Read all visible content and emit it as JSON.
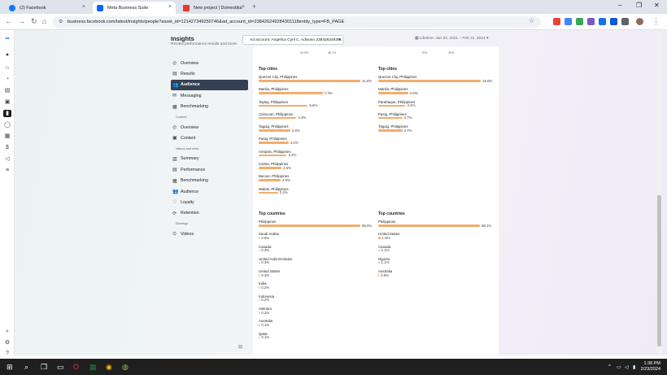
{
  "browser": {
    "tabs": [
      {
        "label": "(2) Facebook",
        "color": "#1877f2"
      },
      {
        "label": "Meta Business Suite",
        "color": "#0866ff"
      },
      {
        "label": "New project | Domestika",
        "color": "#e03c31"
      }
    ],
    "new_tab": "+",
    "url": "business.facebook.com/latest/insights/people?asset_id=121427349250746&ad_account_id=238426249284301118entity_type=FB_PAGE"
  },
  "header": {
    "title": "Insights",
    "subtitle": "Review performance results and more.",
    "ad_account": "Ad account: Angelica Cyril C. Adivoso 23842624928...",
    "date_range": "Lifetime: Jan 22, 2021 – Feb 21, 2024"
  },
  "nav": {
    "items_top": [
      {
        "label": "Overview",
        "icon": "overview-icon",
        "glyph": "◎"
      },
      {
        "label": "Results",
        "icon": "results-icon",
        "glyph": "▤"
      },
      {
        "label": "Audience",
        "icon": "audience-icon",
        "glyph": "👥",
        "active": true
      },
      {
        "label": "Messaging",
        "icon": "messaging-icon",
        "glyph": "✉"
      },
      {
        "label": "Benchmarking",
        "icon": "benchmarking-icon",
        "glyph": "▦"
      }
    ],
    "content_section": "Content",
    "items_content": [
      {
        "label": "Overview",
        "icon": "overview-icon",
        "glyph": "◎"
      },
      {
        "label": "Content",
        "icon": "content-icon",
        "glyph": "▣"
      }
    ],
    "videos_section": "Videos and reels",
    "items_videos": [
      {
        "label": "Summary",
        "icon": "summary-icon",
        "glyph": "▥"
      },
      {
        "label": "Performance",
        "icon": "performance-icon",
        "glyph": "▤"
      },
      {
        "label": "Benchmarking",
        "icon": "benchmarking-icon",
        "glyph": "▦"
      },
      {
        "label": "Audience",
        "icon": "audience-icon",
        "glyph": "👥"
      },
      {
        "label": "Loyalty",
        "icon": "loyalty-icon",
        "glyph": "♡"
      },
      {
        "label": "Retention",
        "icon": "retention-icon",
        "glyph": "⟳"
      }
    ],
    "earnings_section": "Earnings",
    "items_earnings": [
      {
        "label": "Videos",
        "icon": "videos-icon",
        "glyph": "⊙"
      }
    ]
  },
  "top_pcts": {
    "left_a": "53.9%",
    "left_b": "46.1%",
    "right_a": "70%",
    "right_b": "30%"
  },
  "left_cities": {
    "title": "Top cities",
    "rows": [
      {
        "name": "Quezon City, Philippines",
        "label": "11.6%",
        "value": 11.6
      },
      {
        "name": "Manila, Philippines",
        "label": "7.3%",
        "value": 7.3
      },
      {
        "name": "Taytay, Philippines",
        "label": "5.6%",
        "value": 5.6
      },
      {
        "name": "Caloocan, Philippines",
        "label": "4.3%",
        "value": 4.3
      },
      {
        "name": "Taguig, Philippines",
        "label": "3.6%",
        "value": 3.6
      },
      {
        "name": "Pasig, Philippines",
        "label": "3.4%",
        "value": 3.4
      },
      {
        "name": "Antipolo, Philippines",
        "label": "3.2%",
        "value": 3.2
      },
      {
        "name": "Cainta, Philippines",
        "label": "2.6%",
        "value": 2.6
      },
      {
        "name": "Bacoor, Philippines",
        "label": "2.5%",
        "value": 2.5
      },
      {
        "name": "Makati, Philippines",
        "label": "2.2%",
        "value": 2.2
      }
    ]
  },
  "right_cities": {
    "title": "Top cities",
    "rows": [
      {
        "name": "Quezon City, Philippines",
        "label": "15.8%",
        "value": 15.8
      },
      {
        "name": "Manila, Philippines",
        "label": "4.6%",
        "value": 4.6
      },
      {
        "name": "Parañaque, Philippines",
        "label": "4.2%",
        "value": 4.2
      },
      {
        "name": "Pasig, Philippines",
        "label": "3.7%",
        "value": 3.7
      },
      {
        "name": "Taguig, Philippines",
        "label": "3.7%",
        "value": 3.7
      }
    ]
  },
  "left_countries": {
    "title": "Top countries",
    "rows": [
      {
        "name": "Philippines",
        "label": "95.6%",
        "value": 95.6
      },
      {
        "name": "Saudi Arabia",
        "label": "0.8%",
        "value": 0.8
      },
      {
        "name": "Canada",
        "label": "0.3%",
        "value": 0.3
      },
      {
        "name": "United Arab Emirates",
        "label": "0.3%",
        "value": 0.3
      },
      {
        "name": "United States",
        "label": "0.3%",
        "value": 0.3
      },
      {
        "name": "India",
        "label": "0.2%",
        "value": 0.2
      },
      {
        "name": "Indonesia",
        "label": "0.2%",
        "value": 0.2
      },
      {
        "name": "Vietnam",
        "label": "0.2%",
        "value": 0.2
      },
      {
        "name": "Australia",
        "label": "0.1%",
        "value": 0.1
      },
      {
        "name": "Qatar",
        "label": "0.1%",
        "value": 0.1
      }
    ]
  },
  "right_countries": {
    "title": "Top countries",
    "rows": [
      {
        "name": "Philippines",
        "label": "88.1%",
        "value": 88.1
      },
      {
        "name": "United States",
        "label": "1.8%",
        "value": 1.8
      },
      {
        "name": "Canada",
        "label": "1.1%",
        "value": 1.1
      },
      {
        "name": "Nigeria",
        "label": "1.1%",
        "value": 1.1
      },
      {
        "name": "Australia",
        "label": "0.9%",
        "value": 0.9
      }
    ]
  },
  "taskbar": {
    "time": "1:38 PM",
    "date": "2/23/2024"
  },
  "colors": {
    "bar": "#f2ad6e",
    "active_nav": "#344054"
  }
}
